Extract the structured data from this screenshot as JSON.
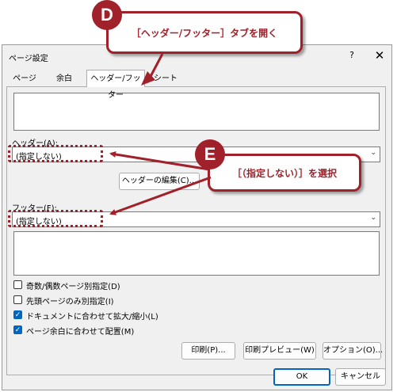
{
  "dialog": {
    "title": "ページ設定",
    "help": "?",
    "close": "✕",
    "tabs": [
      "ページ",
      "余白",
      "ヘッダー/フッター",
      "シート"
    ],
    "active_tab": "ヘッダー/フッター",
    "header_label": "ヘッダー(A):",
    "header_value": "(指定しない)",
    "edit_header": "ヘッダーの編集(C)...",
    "footer_label": "フッター(F):",
    "footer_value": "(指定しない)",
    "checks": [
      {
        "label": "奇数/偶数ページ別指定(D)",
        "checked": false
      },
      {
        "label": "先頭ページのみ別指定(I)",
        "checked": false
      },
      {
        "label": "ドキュメントに合わせて拡大/縮小(L)",
        "checked": true
      },
      {
        "label": "ページ余白に合わせて配置(M)",
        "checked": true
      }
    ],
    "print_button": "印刷(P)...",
    "preview_button": "印刷プレビュー(W)",
    "options_button": "オプション(O)...",
    "ok_button": "OK",
    "cancel_button": "キャンセル"
  },
  "annotations": {
    "d_badge": "D",
    "d_text": "［ヘッダー/フッター］タブを開く",
    "e_badge": "E",
    "e_text": "［（指定しない）］を選択",
    "color": "#a0212a"
  }
}
